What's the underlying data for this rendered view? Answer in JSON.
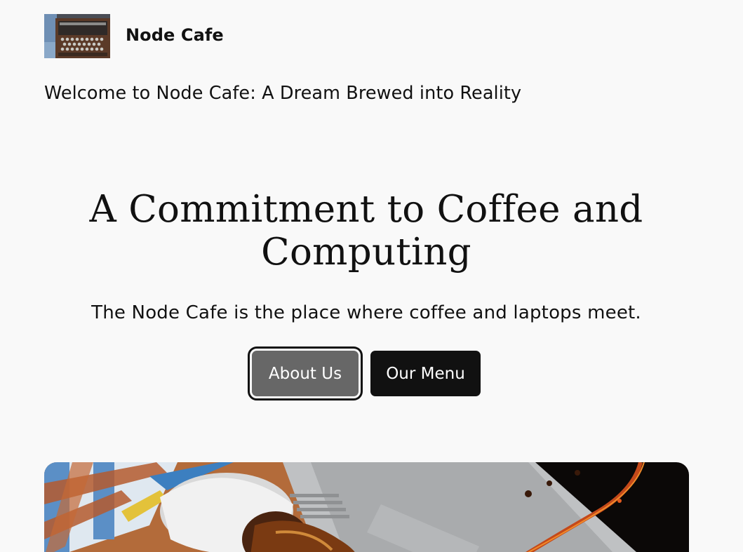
{
  "header": {
    "site_title": "Node Cafe",
    "tagline": "Welcome to Node Cafe: A Dream Brewed into Reality",
    "logo_icon": "enigma-machine-photo"
  },
  "hero": {
    "heading": "A Commitment to Coffee and Computing",
    "subheading": "The Node Cafe is the place where coffee and laptops meet.",
    "buttons": {
      "about_label": "About Us",
      "menu_label": "Our Menu"
    },
    "image_icon": "coffee-spilled-on-laptop-photo"
  },
  "colors": {
    "background": "#f9f9f9",
    "text": "#111111",
    "button_primary": "#111111",
    "button_focused": "#676767"
  }
}
